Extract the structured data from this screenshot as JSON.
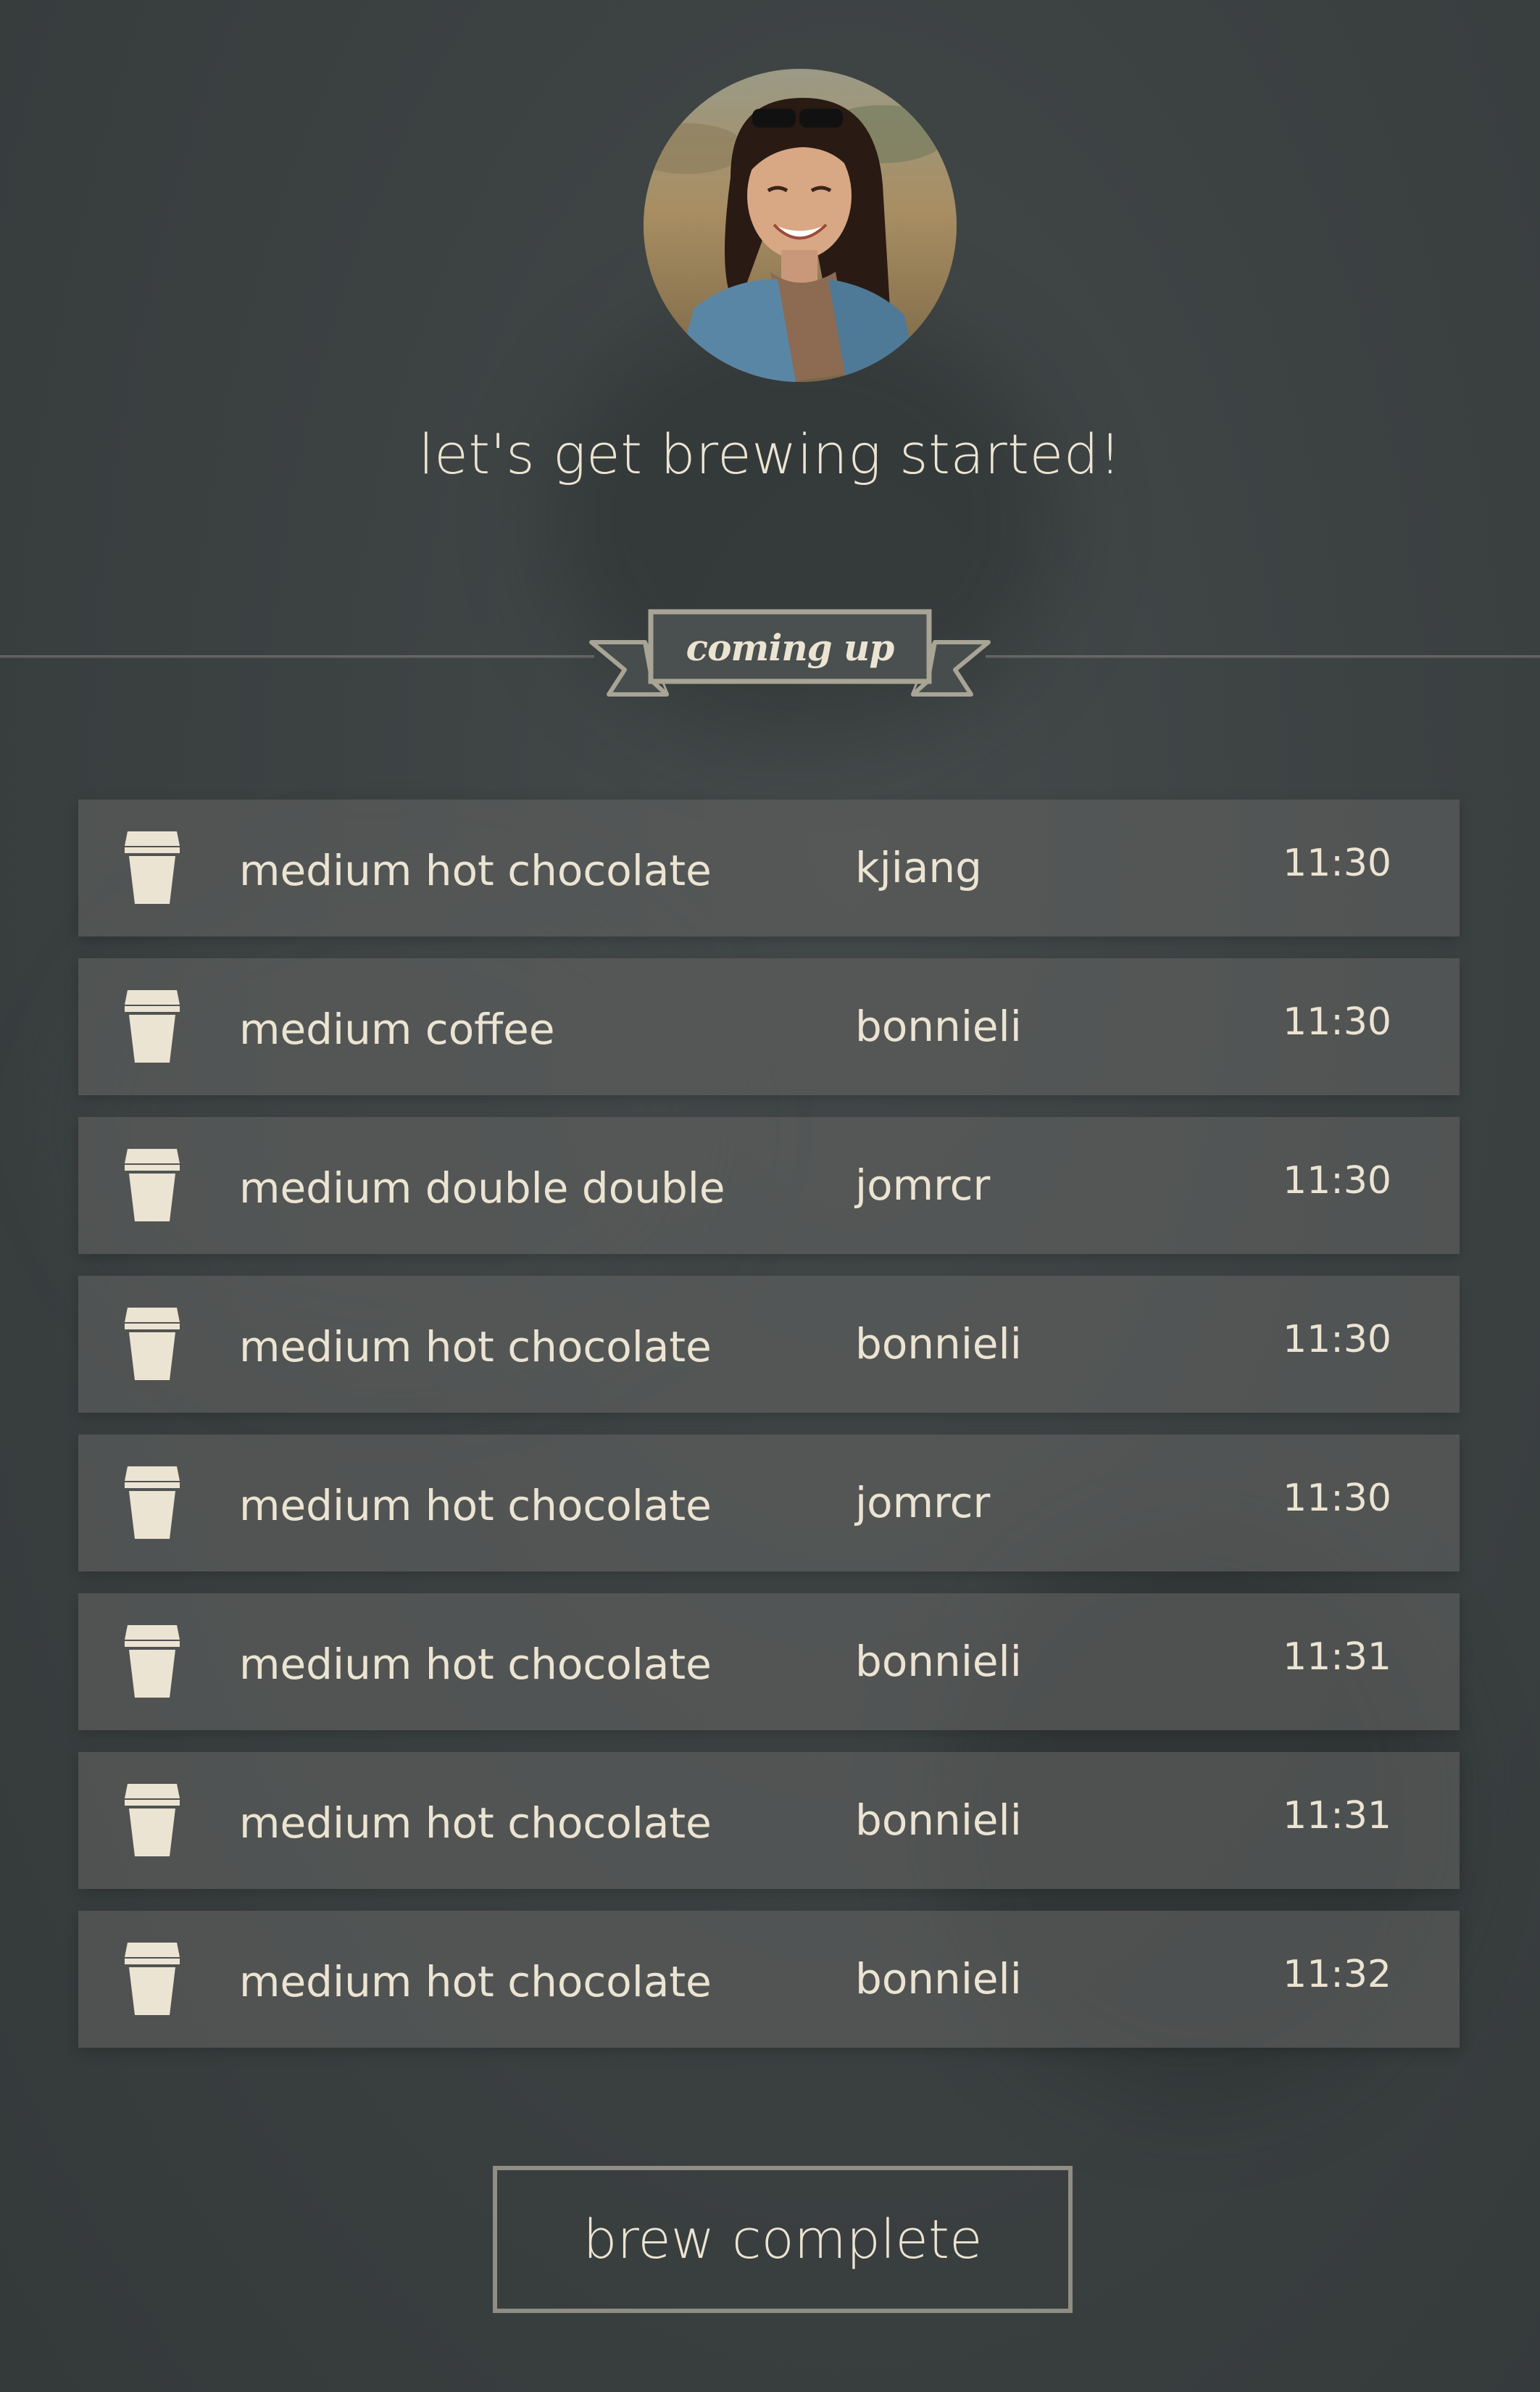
{
  "profile": {
    "avatar_icon": "user-avatar-photo"
  },
  "heading": "let's get brewing started!",
  "section": {
    "label": "coming up"
  },
  "orders": [
    {
      "drink": "medium hot chocolate",
      "user": "kjiang",
      "time": "11:30",
      "icon": "coffee-cup-icon"
    },
    {
      "drink": "medium coffee",
      "user": "bonnieli",
      "time": "11:30",
      "icon": "coffee-cup-icon"
    },
    {
      "drink": "medium double double",
      "user": "jomrcr",
      "time": "11:30",
      "icon": "coffee-cup-icon"
    },
    {
      "drink": "medium hot chocolate",
      "user": "bonnieli",
      "time": "11:30",
      "icon": "coffee-cup-icon"
    },
    {
      "drink": "medium hot chocolate",
      "user": "jomrcr",
      "time": "11:30",
      "icon": "coffee-cup-icon"
    },
    {
      "drink": "medium hot chocolate",
      "user": "bonnieli",
      "time": "11:31",
      "icon": "coffee-cup-icon"
    },
    {
      "drink": "medium hot chocolate",
      "user": "bonnieli",
      "time": "11:31",
      "icon": "coffee-cup-icon"
    },
    {
      "drink": "medium hot chocolate",
      "user": "bonnieli",
      "time": "11:32",
      "icon": "coffee-cup-icon"
    }
  ],
  "actions": {
    "brew_complete_label": "brew complete"
  },
  "colors": {
    "background": "#3d4243",
    "text": "#ece4d2",
    "row_background": "#5a5c5a",
    "button_border": "#8f8d84"
  }
}
